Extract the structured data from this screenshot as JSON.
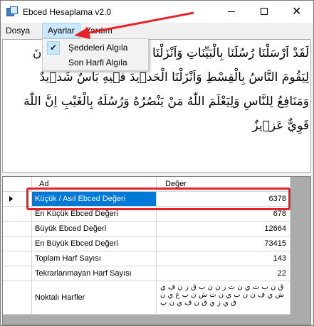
{
  "window": {
    "title": "Ebced Hesaplama v2.0",
    "icons": {
      "app": "app-icon",
      "minimize": "minimize-icon",
      "maximize": "maximize-icon",
      "close": "close-icon"
    }
  },
  "menubar": {
    "items": [
      {
        "label": "Dosya"
      },
      {
        "label": "Ayarlar"
      },
      {
        "label": "Yardım"
      }
    ]
  },
  "dropdown": {
    "items": [
      {
        "label": "Şeddeleri Algıla",
        "checked": true
      },
      {
        "label": "Son Harfi Algıla",
        "checked": false
      }
    ]
  },
  "textarea": {
    "text": "لَقَدْ اَرْسَلْنَا رُسُلَنَا بِالْبَيِّنَاتِ وَاَنْزَلْنَا مَعَهُمُ الْكِتَابَ وَالْم۪يزَانَ لِيَقُومَ النَّاسُ بِالْقِسْطِ وَاَنْزَلْنَا الْحَد۪يدَ ف۪يهِ بَأْسٌ شَد۪يدٌ وَمَنَافِعُ لِلنَّاسِ وَلِيَعْلَمَ اللّٰهُ مَنْ يَنْصُرُهُ وَرُسُلَهُ بِالْغَيْبِ اِنَّ اللّٰهَ قَوِيٌّ عَز۪يزٌ"
  },
  "grid": {
    "headers": {
      "name": "Ad",
      "value": "Değer"
    },
    "rows": [
      {
        "name": "Küçük / Asıl Ebced Değeri",
        "value": "6378",
        "selected": true
      },
      {
        "name": "En Küçük Ebced Değeri",
        "value": "678"
      },
      {
        "name": "Büyük Ebced Değeri",
        "value": "12664"
      },
      {
        "name": "En Büyük Ebced Değeri",
        "value": "73415"
      },
      {
        "name": "Toplam Harf Sayısı",
        "value": "143"
      },
      {
        "name": "Tekrarlanmayan Harf Sayısı",
        "value": "22"
      },
      {
        "name": "Noktalı Harfler",
        "value": "ق ن ب ت ي ن ت ز ن ن ب ق ز ن ف ي ش ي ف ن ن ب ي ن ت ش ن ب غ ي ن ق ي ز ي ق ن ف ي ن ب"
      }
    ]
  },
  "colors": {
    "selection": "#0078d7",
    "menu_highlight": "#cce8ff",
    "annotation": "#e8222a"
  }
}
